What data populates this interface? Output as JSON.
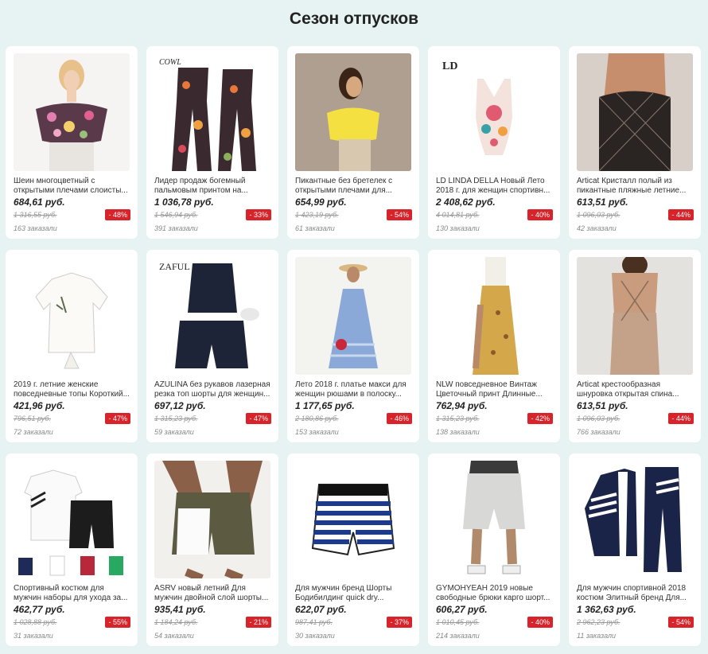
{
  "title": "Сезон отпусков",
  "products": [
    {
      "name": "Шеин многоцветный с открытыми плечами слоисты...",
      "price": "684,61 руб.",
      "old": "1 316,55 руб.",
      "discount": "- 48%",
      "orders": "163 заказали",
      "image": "floral-off-shoulder-top"
    },
    {
      "name": "Лидер продаж богемный пальмовым принтом на...",
      "price": "1 036,78 руб.",
      "old": "1 546,94 руб.",
      "discount": "- 33%",
      "orders": "391 заказали",
      "image": "palm-print-jumpsuit"
    },
    {
      "name": "Пикантные без бретелек с открытыми плечами для...",
      "price": "654,99 руб.",
      "old": "1 423,19 руб.",
      "discount": "- 54%",
      "orders": "61 заказали",
      "image": "yellow-off-shoulder-top"
    },
    {
      "name": "LD LINDA DELLA Новый Лето 2018 г. для женщин спортивн...",
      "price": "2 408,62 руб.",
      "old": "4 014,81 руб.",
      "discount": "- 40%",
      "orders": "130 заказали",
      "image": "printed-swimsuit"
    },
    {
      "name": "Articat Кристалл полый из пикантные пляжные летние...",
      "price": "613,51 руб.",
      "old": "1 096,03 руб.",
      "discount": "- 44%",
      "orders": "42 заказали",
      "image": "crystal-mesh-skirt"
    },
    {
      "name": "2019 г. летние женские повседневные топы Короткий...",
      "price": "421,96 руб.",
      "old": "796,51 руб.",
      "discount": "- 47%",
      "orders": "72 заказали",
      "image": "white-tie-front-shirt"
    },
    {
      "name": "AZULINA без рукавов лазерная резка топ шорты для женщин...",
      "price": "697,12 руб.",
      "old": "1 315,23 руб.",
      "discount": "- 47%",
      "orders": "59 заказали",
      "image": "navy-top-shorts-set"
    },
    {
      "name": "Лето 2018 г. платье макси для женщин рюшами в полоску...",
      "price": "1 177,65 руб.",
      "old": "2 180,86 руб.",
      "discount": "- 46%",
      "orders": "153 заказали",
      "image": "striped-maxi-dress"
    },
    {
      "name": "NLW повседневное Винтаж Цветочный принт Длинные...",
      "price": "762,94 руб.",
      "old": "1 315,23 руб.",
      "discount": "- 42%",
      "orders": "138 заказали",
      "image": "floral-wrap-skirt"
    },
    {
      "name": "Articat крестообразная шнуровка открытая спина...",
      "price": "613,51 руб.",
      "old": "1 096,03 руб.",
      "discount": "- 44%",
      "orders": "766 заказали",
      "image": "beige-backless-dress"
    },
    {
      "name": "Спортивный костюм для мужчин наборы для ухода за...",
      "price": "462,77 руб.",
      "old": "1 028,88 руб.",
      "discount": "- 55%",
      "orders": "31 заказали",
      "image": "mens-polo-shorts-set"
    },
    {
      "name": "ASRV новый летний Для мужчин двойной слой шорты...",
      "price": "935,41 руб.",
      "old": "1 184,24 руб.",
      "discount": "- 21%",
      "orders": "54 заказали",
      "image": "double-layer-shorts"
    },
    {
      "name": "Для мужчин бренд Шорты Бодибилдинг quick dry...",
      "price": "622,07 руб.",
      "old": "987,41 руб.",
      "discount": "- 37%",
      "orders": "30 заказали",
      "image": "striped-board-shorts"
    },
    {
      "name": "GYMOHYEAH 2019 новые свободные брюки карго шорт...",
      "price": "606,27 руб.",
      "old": "1 010,45 руб.",
      "discount": "- 40%",
      "orders": "214 заказали",
      "image": "grey-cargo-shorts"
    },
    {
      "name": "Для мужчин спортивной 2018 костюм Элитный бренд Для...",
      "price": "1 362,63 руб.",
      "old": "2 962,23 руб.",
      "discount": "- 54%",
      "orders": "11 заказали",
      "image": "navy-tracksuit"
    }
  ]
}
